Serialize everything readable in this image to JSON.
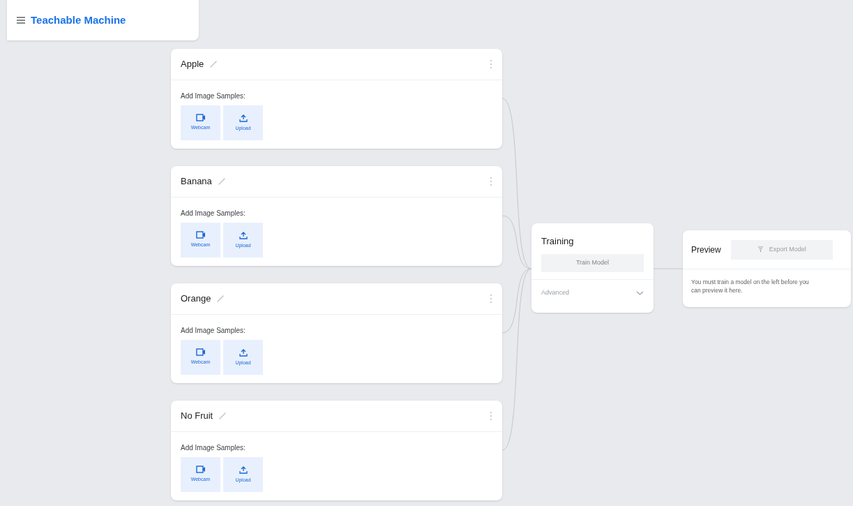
{
  "app_bar": {
    "title": "Teachable Machine"
  },
  "classes": [
    {
      "name": "Apple",
      "samples_label": "Add Image Samples:",
      "buttons": [
        {
          "kind": "webcam",
          "label": "Webcam"
        },
        {
          "kind": "upload",
          "label": "Upload"
        }
      ]
    },
    {
      "name": "Banana",
      "samples_label": "Add Image Samples:",
      "buttons": [
        {
          "kind": "webcam",
          "label": "Webcam"
        },
        {
          "kind": "upload",
          "label": "Upload"
        }
      ]
    },
    {
      "name": "Orange",
      "samples_label": "Add Image Samples:",
      "buttons": [
        {
          "kind": "webcam",
          "label": "Webcam"
        },
        {
          "kind": "upload",
          "label": "Upload"
        }
      ]
    },
    {
      "name": "No Fruit",
      "samples_label": "Add Image Samples:",
      "buttons": [
        {
          "kind": "webcam",
          "label": "Webcam"
        },
        {
          "kind": "upload",
          "label": "Upload"
        }
      ]
    }
  ],
  "training": {
    "title": "Training",
    "button": "Train Model",
    "advanced": "Advanced"
  },
  "preview": {
    "title": "Preview",
    "export_button": "Export Model",
    "message": "You must train a model on the left before you can preview it here."
  }
}
